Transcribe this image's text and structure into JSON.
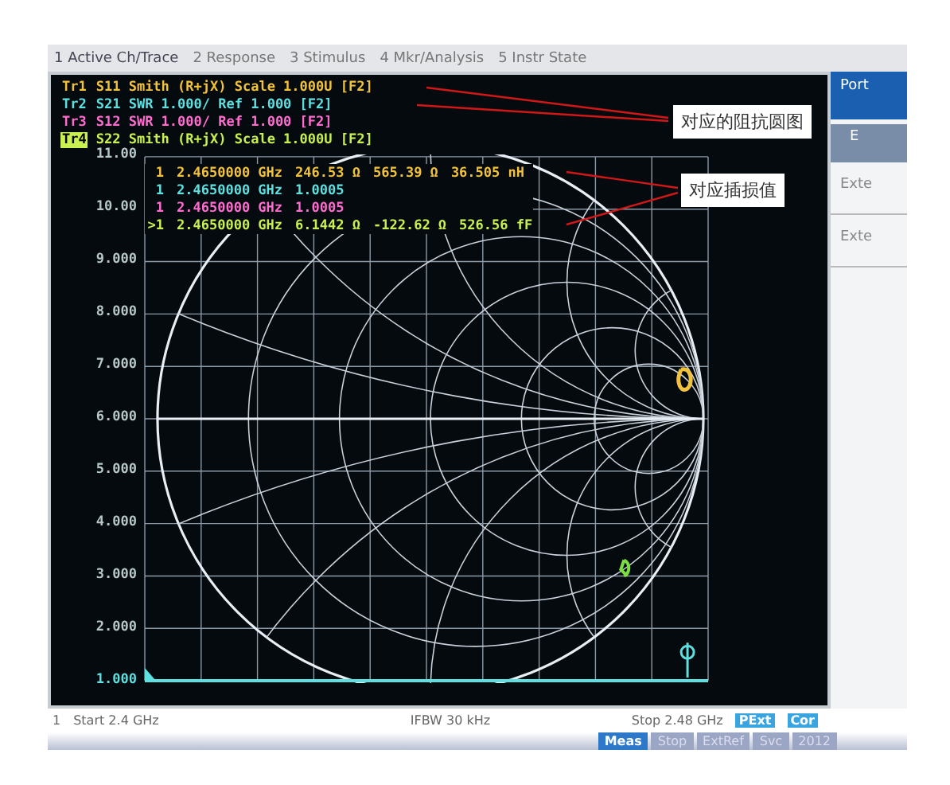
{
  "menu": [
    {
      "label": "1 Active Ch/Trace",
      "selected": true
    },
    {
      "label": "2 Response",
      "selected": false
    },
    {
      "label": "3 Stimulus",
      "selected": false
    },
    {
      "label": "4 Mkr/Analysis",
      "selected": false
    },
    {
      "label": "5 Instr State",
      "selected": false
    }
  ],
  "traces": [
    {
      "label": "Tr1",
      "text": "S11 Smith (R+jX) Scale 1.000U [F2]",
      "color": "#f2c23a",
      "selected": false
    },
    {
      "label": "Tr2",
      "text": "S21 SWR 1.000/ Ref 1.000 [F2]",
      "color": "#5fe0e0",
      "selected": false
    },
    {
      "label": "Tr3",
      "text": "S12 SWR 1.000/ Ref 1.000 [F2]",
      "color": "#ff6ccf",
      "selected": false
    },
    {
      "label": "Tr4",
      "text": "S22 Smith (R+jX) Scale 1.000U [F2]",
      "color": "#c8f050",
      "selected": true
    }
  ],
  "markers": [
    {
      "label": "1",
      "values": [
        "2.4650000 GHz",
        "246.53 Ω",
        "565.39 Ω",
        "36.505 nH"
      ],
      "color": "#f2c23a"
    },
    {
      "label": "1",
      "values": [
        "2.4650000 GHz",
        "1.0005"
      ],
      "color": "#5fe0e0"
    },
    {
      "label": "1",
      "values": [
        "2.4650000 GHz",
        "1.0005"
      ],
      "color": "#ff6ccf"
    },
    {
      "label": ">1",
      "values": [
        "2.4650000 GHz",
        "6.1442 Ω",
        "-122.62 Ω",
        "526.56 fF"
      ],
      "color": "#c8f050"
    }
  ],
  "y_axis": [
    "11.00",
    "10.00",
    "9.000",
    "8.000",
    "7.000",
    "6.000",
    "5.000",
    "4.000",
    "3.000",
    "2.000",
    "1.000"
  ],
  "status_bar": {
    "channel": "1",
    "start": "Start 2.4 GHz",
    "ifbw": "IFBW 30 kHz",
    "stop": "Stop 2.48 GHz",
    "badges": [
      "PExt",
      "Cor"
    ]
  },
  "bottom_buttons": [
    {
      "label": "Meas",
      "selected": true
    },
    {
      "label": "Stop",
      "selected": false
    },
    {
      "label": "ExtRef",
      "selected": false
    },
    {
      "label": "Svc",
      "selected": false
    },
    {
      "label": "2012",
      "selected": false
    }
  ],
  "side_panel": {
    "title": "Port",
    "button": "E",
    "items": [
      "Exte",
      "Exte"
    ]
  },
  "annotations": [
    "对应的阻抗圆图",
    "对应插损值"
  ]
}
